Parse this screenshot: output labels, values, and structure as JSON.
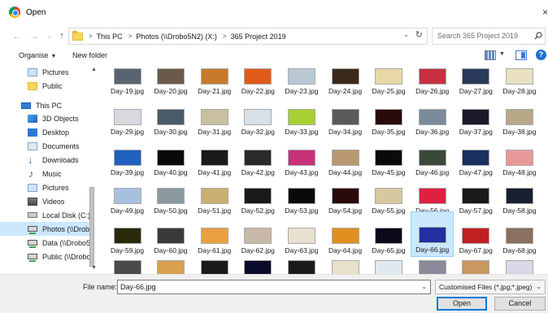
{
  "window": {
    "title": "Open",
    "close_glyph": "×"
  },
  "address": {
    "back_glyph": "←",
    "forward_glyph": "→",
    "dropdown_glyph": "⌄",
    "up_glyph": "↑",
    "crumbs": [
      "This PC",
      "Photos (\\\\Drobo5N2) (X:)",
      "365 Project 2019"
    ],
    "crumb_separator": ">",
    "refresh_glyph": "↻",
    "search_placeholder": "Search 365 Project 2019"
  },
  "toolbar": {
    "organise_label": "Organise",
    "new_folder_label": "New folder"
  },
  "nav": {
    "items": [
      {
        "label": "Pictures",
        "icon": "pictures-folder-icon"
      },
      {
        "label": "Public",
        "icon": "folder-icon"
      },
      {
        "label": "This PC",
        "icon": "this-pc-icon"
      },
      {
        "label": "3D Objects",
        "icon": "3d-objects-icon"
      },
      {
        "label": "Desktop",
        "icon": "desktop-icon"
      },
      {
        "label": "Documents",
        "icon": "documents-icon"
      },
      {
        "label": "Downloads",
        "icon": "downloads-icon"
      },
      {
        "label": "Music",
        "icon": "music-icon"
      },
      {
        "label": "Pictures",
        "icon": "pictures-folder-icon"
      },
      {
        "label": "Videos",
        "icon": "videos-icon"
      },
      {
        "label": "Local Disk (C:)",
        "icon": "local-disk-icon"
      },
      {
        "label": "Photos (\\\\Drobo5N",
        "icon": "network-drive-icon",
        "selected": true
      },
      {
        "label": "Data (\\\\Drobo5N",
        "icon": "network-drive-icon"
      },
      {
        "label": "Public (\\\\Drobo5",
        "icon": "network-drive-icon"
      }
    ]
  },
  "files": {
    "rows": [
      [
        "Day-19.jpg",
        "Day-20.jpg",
        "Day-21.jpg",
        "Day-22.jpg",
        "Day-23.jpg",
        "Day-24.jpg",
        "Day-25.jpg",
        "Day-26.jpg",
        "Day-27.jpg",
        "Day-28.jpg"
      ],
      [
        "Day-29.jpg",
        "Day-30.jpg",
        "Day-31.jpg",
        "Day-32.jpg",
        "Day-33.jpg",
        "Day-34.jpg",
        "Day-35.jpg",
        "Day-36.jpg",
        "Day-37.jpg",
        "Day-38.jpg"
      ],
      [
        "Day-39.jpg",
        "Day-40.jpg",
        "Day-41.jpg",
        "Day-42.jpg",
        "Day-43.jpg",
        "Day-44.jpg",
        "Day-45.jpg",
        "Day-46.jpg",
        "Day-47.jpg",
        "Day-48.jpg"
      ],
      [
        "Day-49.jpg",
        "Day-50.jpg",
        "Day-51.jpg",
        "Day-52.jpg",
        "Day-53.jpg",
        "Day-54.jpg",
        "Day-55.jpg",
        "Day-56.jpg",
        "Day-57.jpg",
        "Day-58.jpg"
      ],
      [
        "Day-59.jpg",
        "Day-60.jpg",
        "Day-61.jpg",
        "Day-62.jpg",
        "Day-63.jpg",
        "Day-64.jpg",
        "Day-65.jpg",
        "Day-66.jpg",
        "Day-67.jpg",
        "Day-68.jpg"
      ]
    ],
    "selected": "Day-66.jpg",
    "thumb_colors": [
      [
        "#5a6470",
        "#6a5a4a",
        "#c87a2a",
        "#e05a1a",
        "#b8c8d4",
        "#3a2a1a",
        "#e8d8a8",
        "#c83040",
        "#2a3a5a",
        "#e8e0c0"
      ],
      [
        "#d8d8e0",
        "#4a5a6a",
        "#c8c0a0",
        "#d8e0e8",
        "#a8d030",
        "#5a5a5a",
        "#2a0a0a",
        "#7a8a9a",
        "#1a1a2a",
        "#b8a888"
      ],
      [
        "#2060c0",
        "#0a0a0a",
        "#1a1a1a",
        "#2a2a2a",
        "#c83078",
        "#b89870",
        "#0a0a0a",
        "#3a4a3a",
        "#1a3060",
        "#e89898"
      ],
      [
        "#a8c0e0",
        "#8a9aa0",
        "#c8b070",
        "#1a1a1a",
        "#0a0a0a",
        "#2a0a0a",
        "#d8c8a0",
        "#e02040",
        "#1a1a1a",
        "#1a2030"
      ],
      [
        "#2a2a0a",
        "#3a3a3a",
        "#e8a040",
        "#c8b8a8",
        "#e8e0d0",
        "#e09020",
        "#0a0a1a",
        "#2030a0",
        "#c02020",
        "#8a7060"
      ],
      [
        "#4a4a4a",
        "#d8a050",
        "#1a1a1a",
        "#0a0a2a",
        "#1a1a1a",
        "#e8e0c8",
        "#e0e8f0",
        "#8a8a9a",
        "#c89860",
        "#d8d8e8"
      ]
    ]
  },
  "bottom": {
    "file_name_label": "File name:",
    "file_name_value": "Day-66.jpg",
    "filter_label": "Customised Files (*.jpg;*.jpeg)",
    "open_label": "Open",
    "cancel_label": "Cancel"
  }
}
